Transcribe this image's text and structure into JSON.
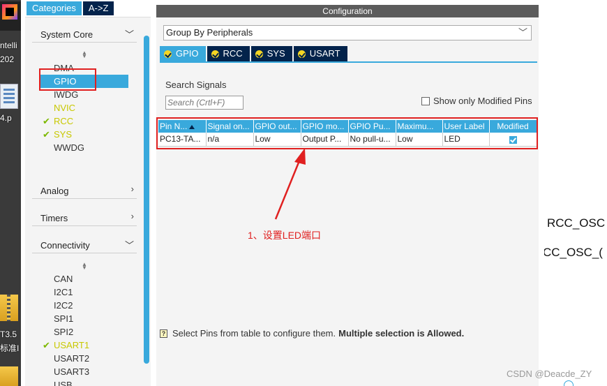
{
  "desktop": {
    "labels": [
      "ntelli",
      "202",
      "4.p",
      "T3.5",
      "标准I"
    ]
  },
  "categories": {
    "tabs": [
      "Categories",
      "A->Z"
    ],
    "groups": [
      {
        "label": "System Core",
        "expanded": true
      },
      {
        "label": "Analog",
        "expanded": false
      },
      {
        "label": "Timers",
        "expanded": false
      },
      {
        "label": "Connectivity",
        "expanded": true
      }
    ],
    "system_core_items": [
      {
        "label": "DMA",
        "state": "normal"
      },
      {
        "label": "GPIO",
        "state": "selected"
      },
      {
        "label": "IWDG",
        "state": "normal"
      },
      {
        "label": "NVIC",
        "state": "warn"
      },
      {
        "label": "RCC",
        "state": "ok"
      },
      {
        "label": "SYS",
        "state": "ok"
      },
      {
        "label": "WWDG",
        "state": "normal"
      }
    ],
    "connectivity_items": [
      {
        "label": "CAN",
        "state": "normal"
      },
      {
        "label": "I2C1",
        "state": "normal"
      },
      {
        "label": "I2C2",
        "state": "normal"
      },
      {
        "label": "SPI1",
        "state": "normal"
      },
      {
        "label": "SPI2",
        "state": "normal"
      },
      {
        "label": "USART1",
        "state": "ok"
      },
      {
        "label": "USART2",
        "state": "normal"
      },
      {
        "label": "USART3",
        "state": "normal"
      },
      {
        "label": "USB",
        "state": "normal"
      }
    ]
  },
  "config": {
    "title": "Configuration",
    "group_by": "Group By Peripherals",
    "tabs": [
      "GPIO",
      "RCC",
      "SYS",
      "USART"
    ],
    "search_label": "Search Signals",
    "search_placeholder": "Search (Crtl+F)",
    "show_modified_label": "Show only Modified Pins",
    "table": {
      "headers": [
        "Pin N...",
        "Signal on...",
        "GPIO out...",
        "GPIO mo...",
        "GPIO Pu...",
        "Maximu...",
        "User Label",
        "Modified"
      ],
      "rows": [
        [
          "PC13-TA...",
          "n/a",
          "Low",
          "Output P...",
          "No pull-u...",
          "Low",
          "LED",
          true
        ]
      ]
    },
    "hint_text": "Select Pins from table to configure them.",
    "hint_bold": "Multiple selection is Allowed."
  },
  "annotation": {
    "text": "1、设置LED端口",
    "color": "#e02020"
  },
  "right_panel": {
    "line1": "RCC_OSC",
    "line2": "CC_OSC_("
  },
  "watermark": "CSDN @Deacde_ZY",
  "colors": {
    "accent": "#39a9dc",
    "dark_tab": "#03234b",
    "title_bar": "#5c5c5c",
    "highlight_box": "#e02020",
    "check_ok": "#7cb800",
    "warn_text": "#c8c800"
  }
}
